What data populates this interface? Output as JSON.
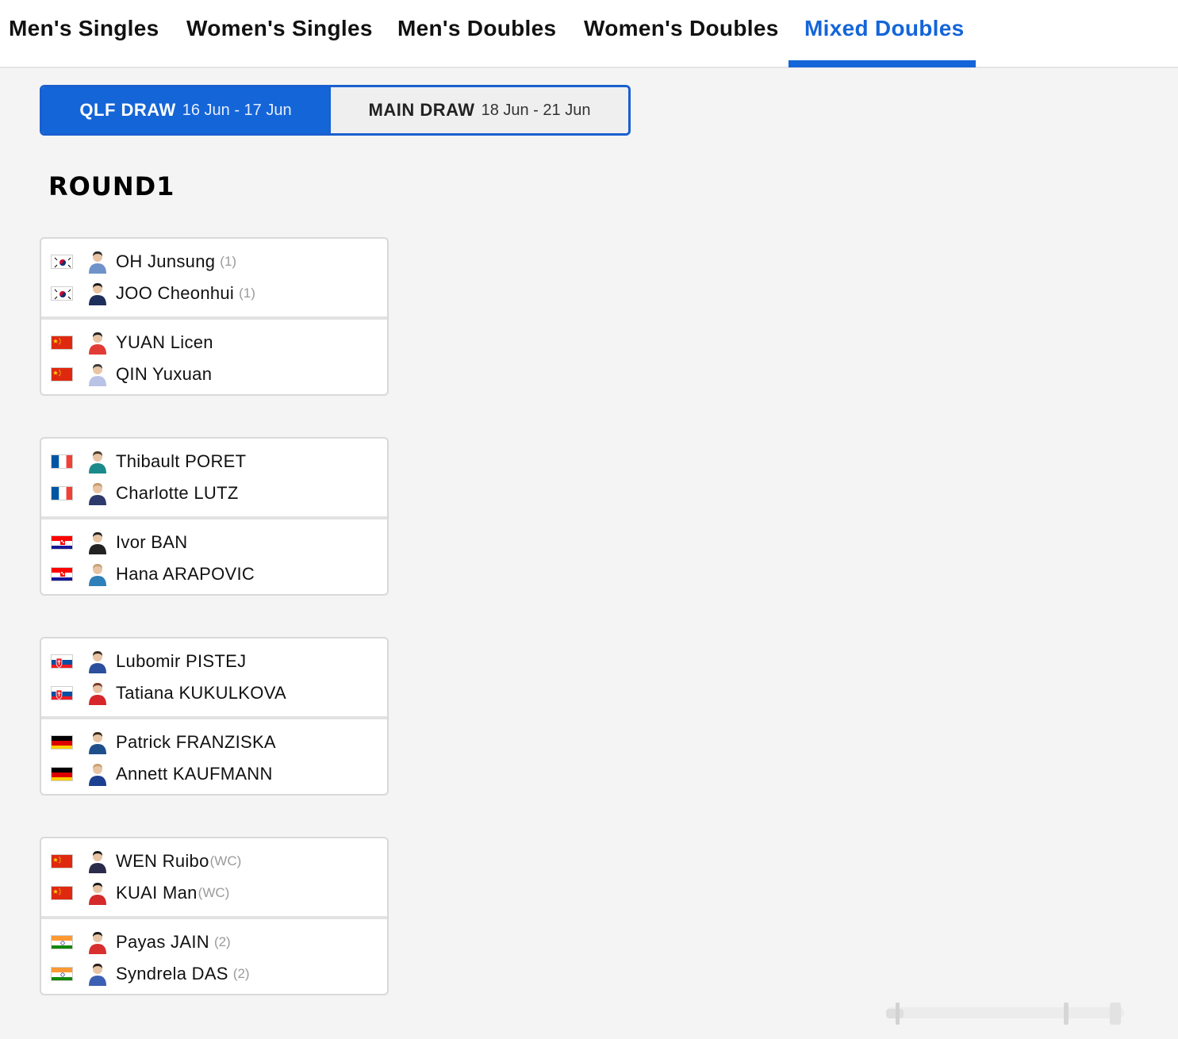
{
  "tabs": [
    {
      "label": "Men's Singles",
      "active": false
    },
    {
      "label": "Women's Singles",
      "active": false
    },
    {
      "label": "Men's Doubles",
      "active": false
    },
    {
      "label": "Women's Doubles",
      "active": false
    },
    {
      "label": "Mixed Doubles",
      "active": true
    }
  ],
  "draw_toggle": {
    "qlf": {
      "label": "QLF DRAW",
      "dates": "16 Jun - 17 Jun",
      "selected": true
    },
    "main": {
      "label": "MAIN DRAW",
      "dates": "18 Jun - 21 Jun",
      "selected": false
    }
  },
  "round_title": "ROUND1",
  "colors": {
    "accent": "#1465d8",
    "background": "#f4f4f4",
    "seed_text": "#9a9a9a"
  },
  "matches": [
    {
      "teams": [
        {
          "country": "KOR",
          "players": [
            {
              "name": "OH Junsung",
              "seed": "(1)"
            },
            {
              "name": "JOO Cheonhui",
              "seed": "(1)"
            }
          ]
        },
        {
          "country": "CHN",
          "players": [
            {
              "name": "YUAN Licen",
              "seed": ""
            },
            {
              "name": "QIN Yuxuan",
              "seed": ""
            }
          ]
        }
      ]
    },
    {
      "teams": [
        {
          "country": "FRA",
          "players": [
            {
              "name": "Thibault PORET",
              "seed": ""
            },
            {
              "name": "Charlotte LUTZ",
              "seed": ""
            }
          ]
        },
        {
          "country": "CRO",
          "players": [
            {
              "name": "Ivor BAN",
              "seed": ""
            },
            {
              "name": "Hana ARAPOVIC",
              "seed": ""
            }
          ]
        }
      ]
    },
    {
      "teams": [
        {
          "country": "SVK",
          "players": [
            {
              "name": "Lubomir PISTEJ",
              "seed": ""
            },
            {
              "name": "Tatiana KUKULKOVA",
              "seed": ""
            }
          ]
        },
        {
          "country": "GER",
          "players": [
            {
              "name": "Patrick FRANZISKA",
              "seed": ""
            },
            {
              "name": "Annett KAUFMANN",
              "seed": ""
            }
          ]
        }
      ]
    },
    {
      "teams": [
        {
          "country": "CHN",
          "players": [
            {
              "name": "WEN Ruibo",
              "seed": "(WC)"
            },
            {
              "name": "KUAI Man",
              "seed": "(WC)"
            }
          ]
        },
        {
          "country": "IND",
          "players": [
            {
              "name": "Payas JAIN",
              "seed": "(2)"
            },
            {
              "name": "Syndrela DAS",
              "seed": "(2)"
            }
          ]
        }
      ]
    }
  ]
}
